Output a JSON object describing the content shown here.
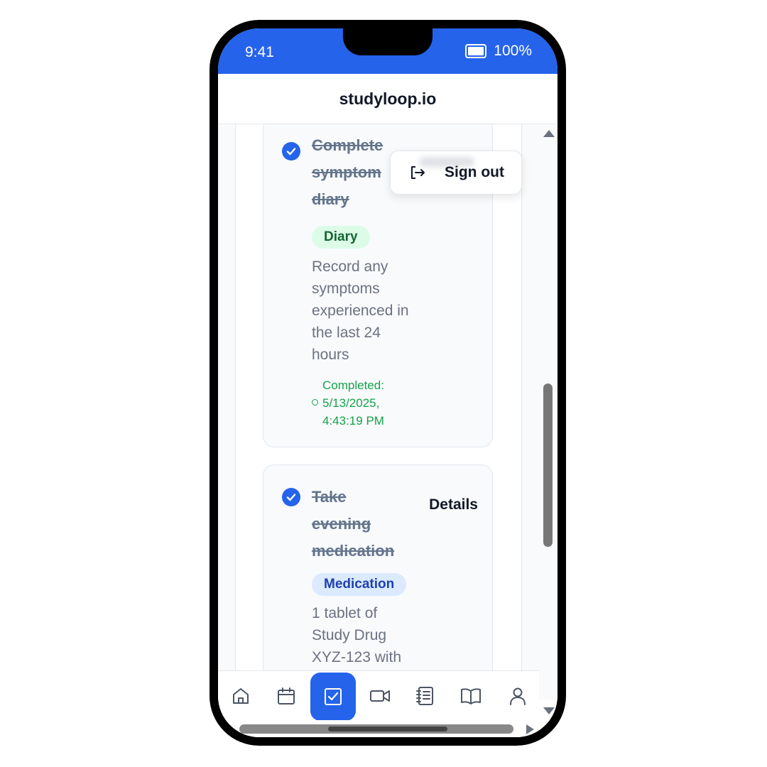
{
  "status_bar": {
    "time": "9:41",
    "battery": "100%"
  },
  "app": {
    "title": "studyloop.io"
  },
  "menu": {
    "sign_out_label": "Sign out"
  },
  "tasks": [
    {
      "title": "Complete symptom diary",
      "tag": "Diary",
      "description": "Record any symptoms experienced in the last 24 hours",
      "completed": "Completed: 5/13/2025, 4:43:19 PM",
      "checked": true
    },
    {
      "title": "Take evening medication",
      "tag": "Medication",
      "description": "1 tablet of Study Drug XYZ-123 with",
      "details_label": "Details",
      "checked": true
    }
  ],
  "bottom_nav": {
    "items": [
      {
        "icon": "home-icon"
      },
      {
        "icon": "calendar-icon"
      },
      {
        "icon": "tasks-icon",
        "active": true
      },
      {
        "icon": "video-icon"
      },
      {
        "icon": "notebook-icon"
      },
      {
        "icon": "book-icon"
      },
      {
        "icon": "user-icon"
      }
    ]
  },
  "colors": {
    "primary": "#2563eb",
    "diary_tag_bg": "#dcfce7",
    "diary_tag_text": "#166534",
    "medication_tag_bg": "#dbeafe",
    "medication_tag_text": "#1e40af",
    "completed_text": "#16a34a"
  }
}
